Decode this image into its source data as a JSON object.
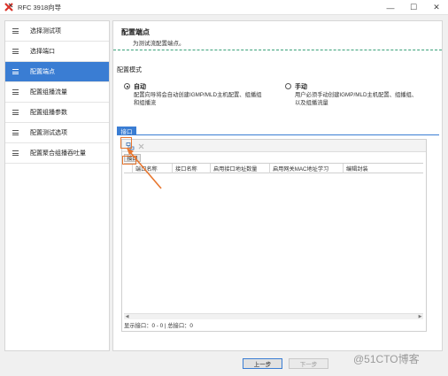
{
  "window": {
    "title": "RFC 3918向导",
    "minimize": "—",
    "maximize": "☐",
    "close": "✕"
  },
  "sidebar": {
    "items": [
      {
        "label": "选择测试项",
        "active": false
      },
      {
        "label": "选择端口",
        "active": false
      },
      {
        "label": "配置端点",
        "active": true
      },
      {
        "label": "配置组播流量",
        "active": false
      },
      {
        "label": "配置组播参数",
        "active": false
      },
      {
        "label": "配置测试选项",
        "active": false
      },
      {
        "label": "配置聚合组播吞吐量",
        "active": false
      }
    ]
  },
  "header": {
    "title": "配置端点",
    "subtitle": "为测试流配置端点。"
  },
  "mode": {
    "label": "配置模式",
    "auto": {
      "title": "自动",
      "desc1": "配置向导将会自动创建IGMP/MLD主机配置、组播组",
      "desc2": "和组播流",
      "checked": true
    },
    "manual": {
      "title": "手动",
      "desc1": "用户必须手动创建IGMP/MLD主机配置、组播组、",
      "desc2": "以及组播流量",
      "checked": false
    }
  },
  "tabs": {
    "port": "接口"
  },
  "port_panel": {
    "inner_tab": "接口",
    "columns": [
      "端口名称",
      "接口名称",
      "启用接口地址数量",
      "启用网关MAC地址学习",
      "编辑封装"
    ],
    "status": "显示接口：0 - 0 | 总接口：0"
  },
  "footer": {
    "prev": "上一步",
    "next": "下一步"
  },
  "watermark": "@51CTO博客",
  "colors": {
    "accent": "#3a7dd3",
    "highlight": "#e8762e",
    "separator": "#3aa17a"
  }
}
